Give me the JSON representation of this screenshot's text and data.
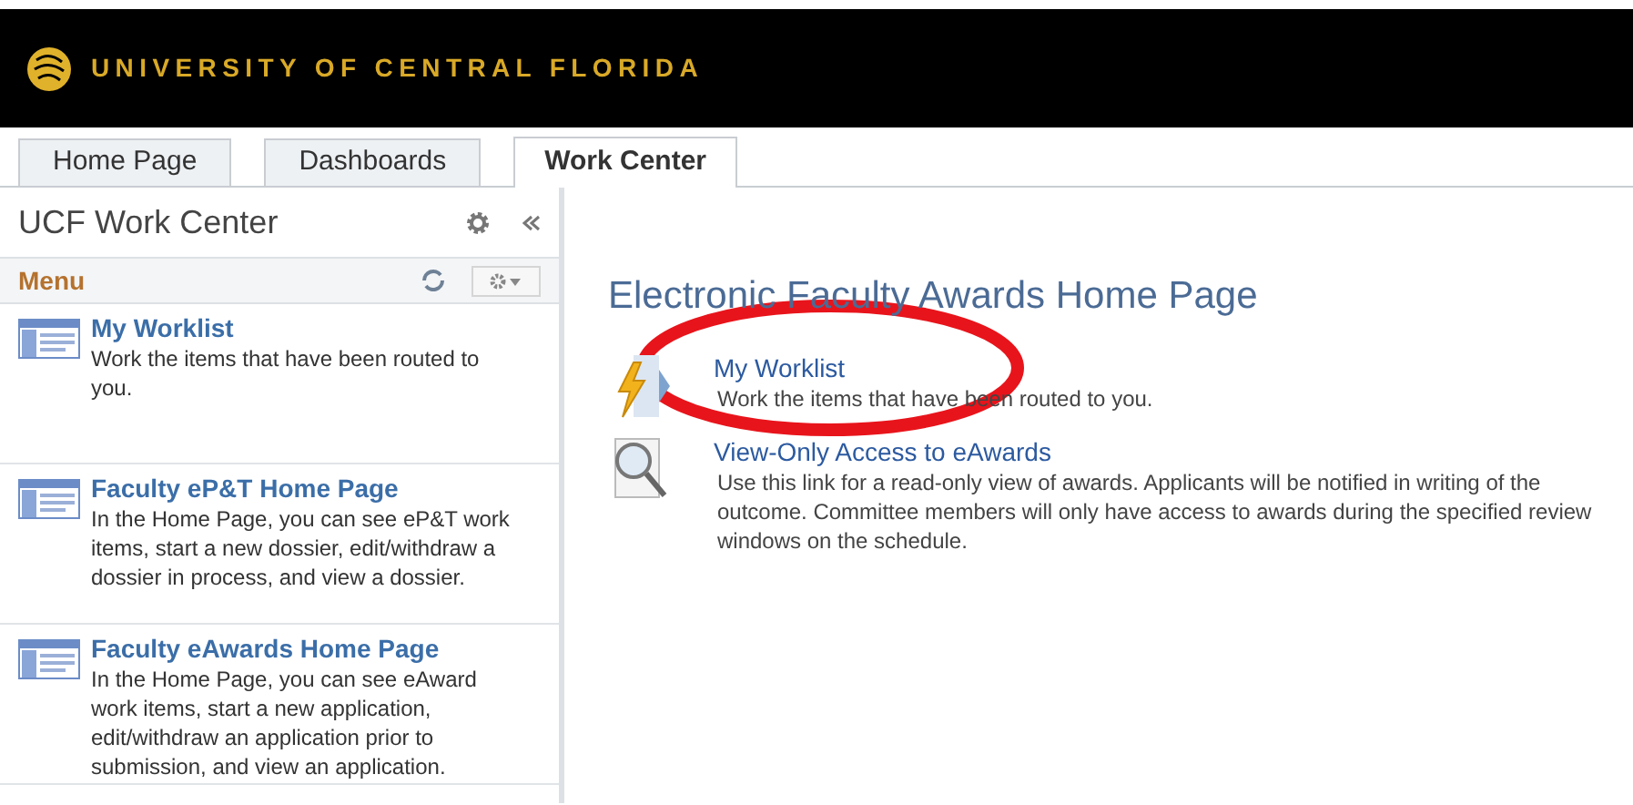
{
  "banner": {
    "title": "UNIVERSITY OF CENTRAL FLORIDA"
  },
  "tabs": [
    {
      "label": "Home Page",
      "selected": false
    },
    {
      "label": "Dashboards",
      "selected": false
    },
    {
      "label": "Work Center",
      "selected": true
    }
  ],
  "sidebar": {
    "title": "UCF Work Center",
    "section": "Menu",
    "items": [
      {
        "title": "My Worklist",
        "description": "Work the items that have been routed to you."
      },
      {
        "title": "Faculty eP&T Home Page",
        "description": "In the Home Page, you can see eP&T work items, start a new dossier, edit/withdraw a dossier in process, and view a dossier."
      },
      {
        "title": "Faculty eAwards Home Page",
        "description": "In the Home Page, you can see eAward work items, start a new application, edit/withdraw an application prior to submission, and view an application."
      }
    ]
  },
  "main": {
    "title": "Electronic Faculty Awards Home Page",
    "links": [
      {
        "kind": "worklist",
        "title": "My Worklist",
        "description": "Work the items that have been routed to you."
      },
      {
        "kind": "search",
        "title": "View-Only Access to eAwards",
        "description": "Use this link for a read-only view of awards. Applicants will be notified in writing of the outcome.  Committee members will only have access to awards during the specified review windows on the schedule."
      }
    ]
  }
}
